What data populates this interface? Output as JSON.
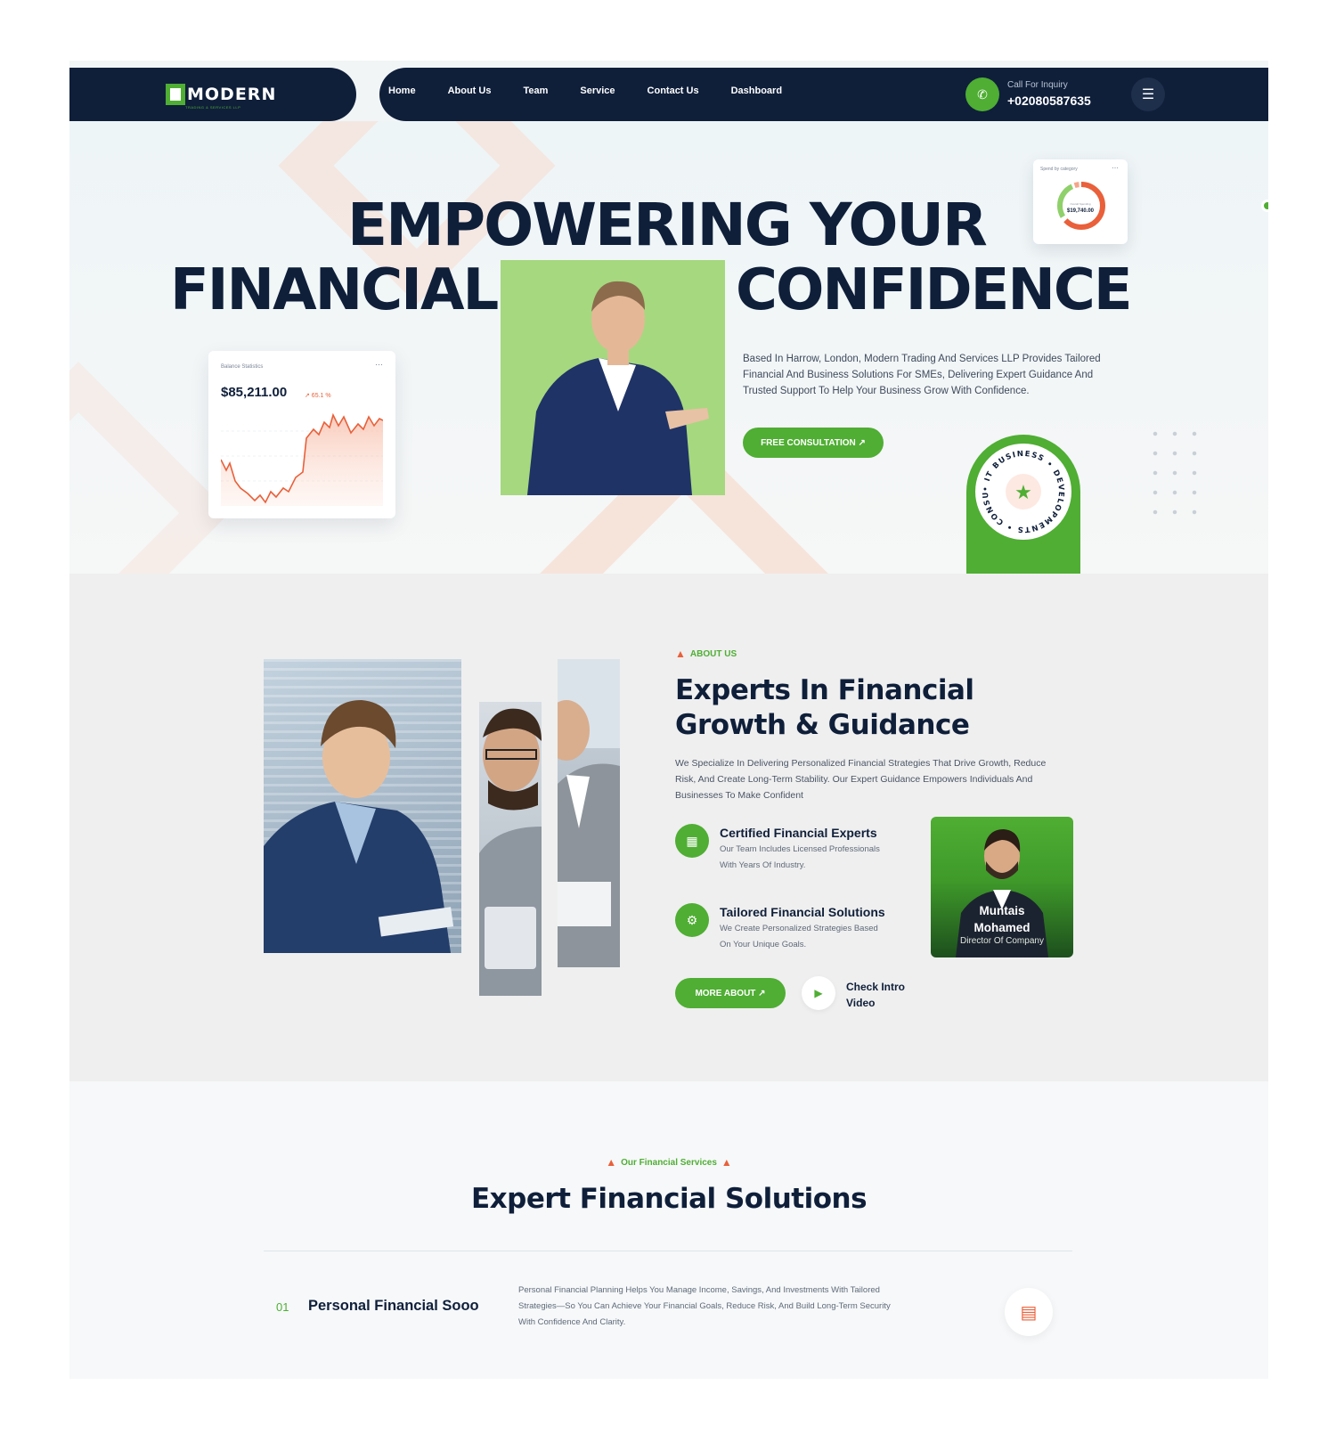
{
  "brand": {
    "logo_text": "MODERN",
    "logo_sub": "TRADING & SERVICES LLP"
  },
  "nav": {
    "links": [
      "Home",
      "About Us",
      "Team",
      "Service",
      "Contact Us",
      "Dashboard"
    ],
    "call_label": "Call For Inquiry",
    "call_number": "+02080587635",
    "icons": {
      "phone": "phone-icon",
      "menu": "menu-icon"
    }
  },
  "hero": {
    "headline_line1": "EMPOWERING YOUR",
    "headline_word_left": "FINANCIAL",
    "headline_word_right": "CONFIDENCE",
    "description": "Based In Harrow, London, Modern Trading And Services LLP Provides Tailored Financial And Business Solutions For SMEs, Delivering Expert Guidance And Trusted Support To Help Your Business Grow With Confidence.",
    "cta_label": "FREE CONSULTATION ↗",
    "spend_card": {
      "title": "Spend by category",
      "sublabel": "Overall Spending",
      "amount": "$19,740.00"
    },
    "balance_card": {
      "title": "Balance Statistics",
      "amount": "$85,211.00",
      "change": "↗ 65.1 %"
    },
    "badge_text": "• IT BUSINESS • DEVELOPMENTS • CONSULTANTS"
  },
  "about": {
    "eyebrow": "ABOUT US",
    "title_line1": "Experts In Financial",
    "title_line2": "Growth & Guidance",
    "description": "We Specialize In Delivering Personalized Financial Strategies That Drive Growth, Reduce Risk, And Create Long-Term Stability. Our Expert Guidance Empowers Individuals And Businesses To Make Confident",
    "features": [
      {
        "title": "Certified Financial Experts",
        "desc": "Our Team Includes Licensed Professionals With Years Of Industry."
      },
      {
        "title": "Tailored Financial Solutions",
        "desc": "We Create Personalized Strategies Based On Your Unique Goals."
      }
    ],
    "director": {
      "name_line1": "Muntais",
      "name_line2": "Mohamed",
      "role": "Director Of Company"
    },
    "more_label": "MORE ABOUT ↗",
    "video_label": "Check Intro Video"
  },
  "services": {
    "eyebrow": "Our Financial Services",
    "title": "Expert Financial Solutions",
    "items": [
      {
        "num": "01",
        "title": "Personal Financial Sooo",
        "desc": "Personal Financial Planning Helps You Manage Income, Savings, And Investments With Tailored Strategies—So You Can Achieve Your Financial Goals, Reduce Risk, And Build Long-Term Security With Confidence And Clarity."
      }
    ]
  },
  "colors": {
    "navy": "#0f1f3a",
    "green": "#4fae33",
    "accent": "#e9603a"
  }
}
